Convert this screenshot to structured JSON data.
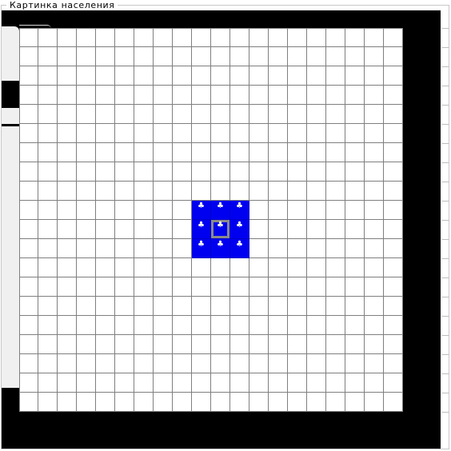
{
  "window": {
    "group_title": "Картинка  населения"
  },
  "board": {
    "rows": 20,
    "cols": 20,
    "populated_cells": [
      [
        9,
        9
      ],
      [
        9,
        10
      ],
      [
        9,
        11
      ],
      [
        10,
        9
      ],
      [
        10,
        10
      ],
      [
        10,
        11
      ],
      [
        11,
        9
      ],
      [
        11,
        10
      ],
      [
        11,
        11
      ]
    ],
    "selected_cell": [
      10,
      10
    ],
    "resident_glyph": "♣",
    "resident_icon": "club-icon"
  },
  "colors": {
    "viewport": "#000000",
    "grid_line": "#7f7f7f",
    "populated": "#0000f0",
    "selection": "#8a8a8a"
  }
}
